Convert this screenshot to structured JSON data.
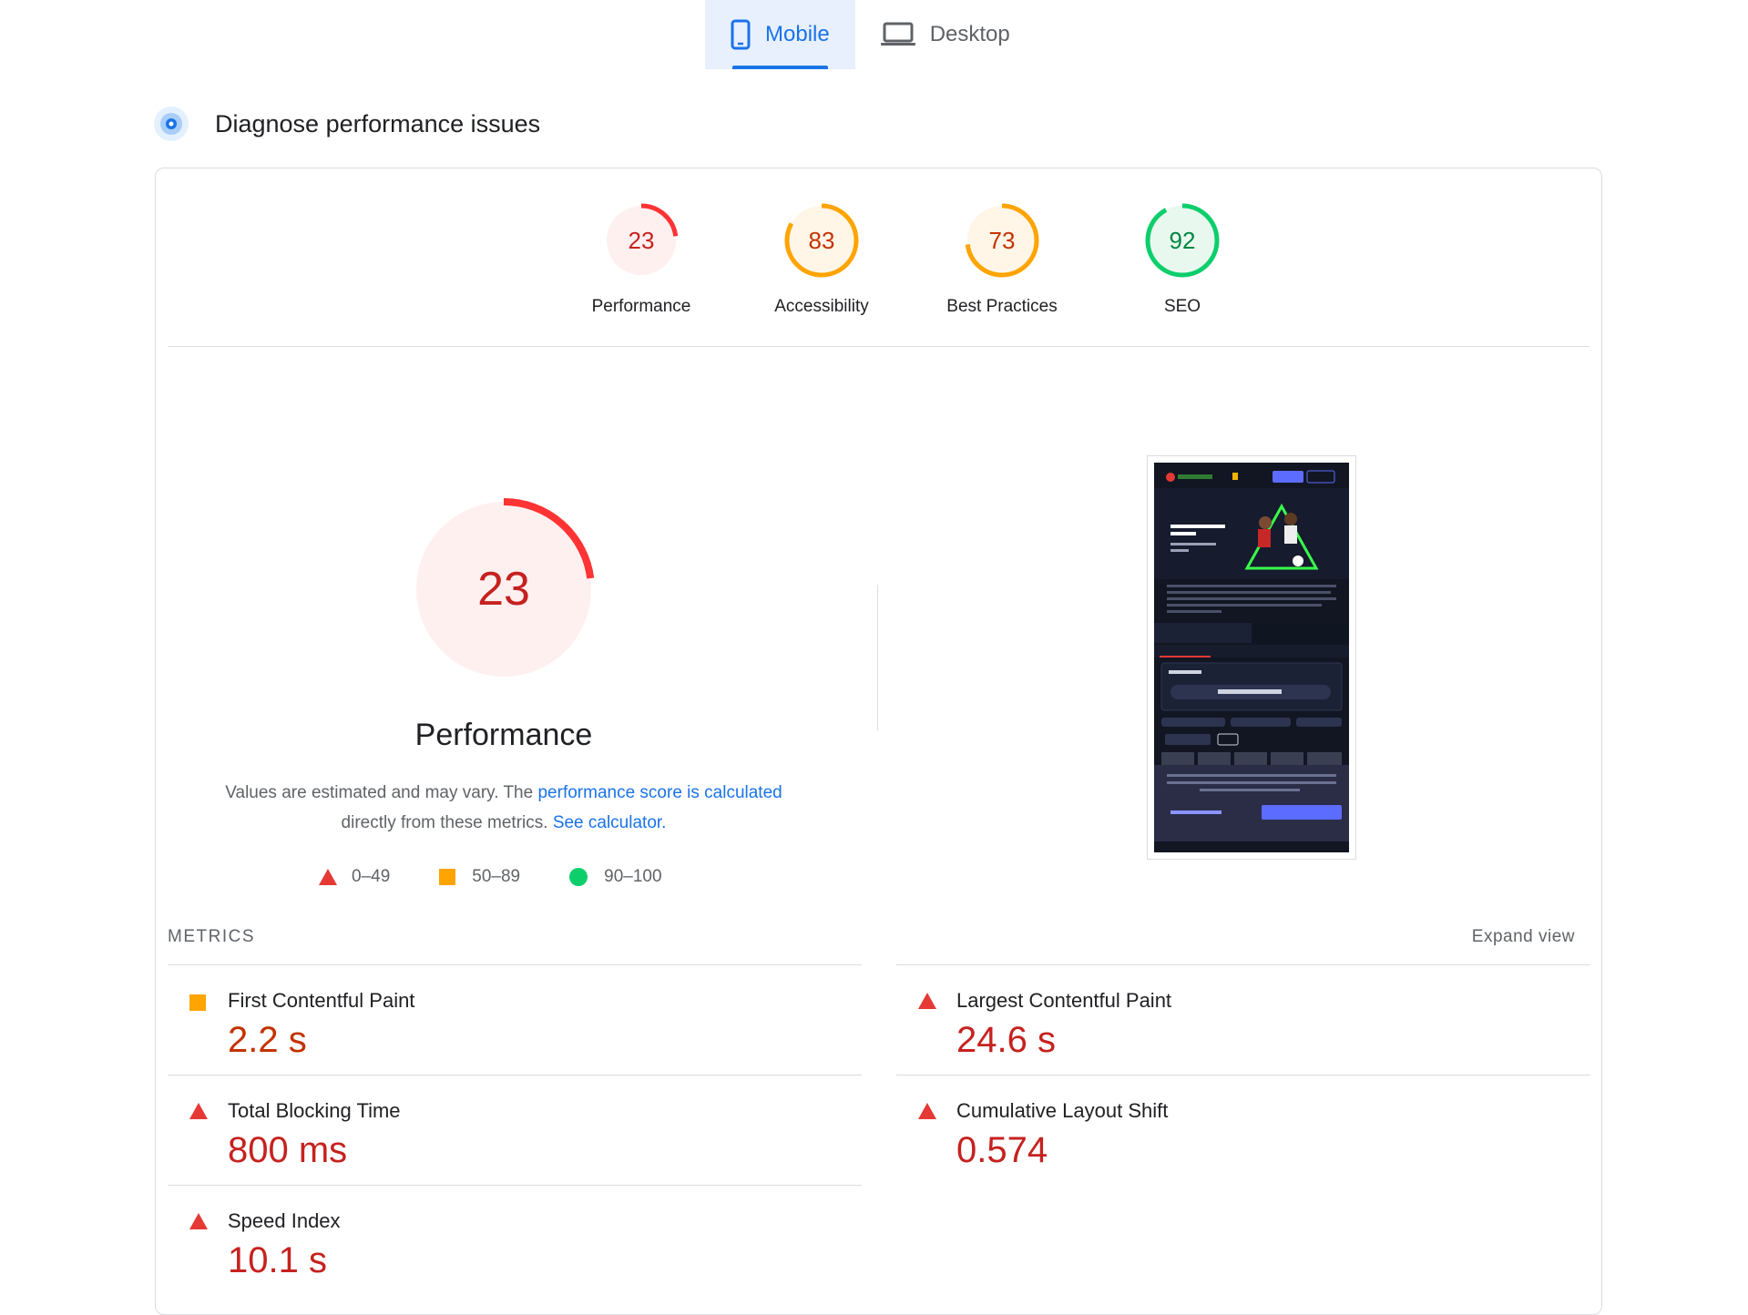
{
  "tabs": [
    {
      "label": "Mobile",
      "active": true,
      "icon": "phone-icon"
    },
    {
      "label": "Desktop",
      "active": false,
      "icon": "laptop-icon"
    }
  ],
  "diagnose": {
    "title": "Diagnose performance issues",
    "icon": "diagnose-icon"
  },
  "categories": [
    {
      "score": "23",
      "label": "Performance",
      "rating": "fail",
      "color": "#ff3333"
    },
    {
      "score": "83",
      "label": "Accessibility",
      "rating": "average",
      "color": "#ffa400"
    },
    {
      "score": "73",
      "label": "Best Practices",
      "rating": "average",
      "color": "#ffa400"
    },
    {
      "score": "92",
      "label": "SEO",
      "rating": "pass",
      "color": "#0cce6b"
    }
  ],
  "performance": {
    "score": "23",
    "title": "Performance",
    "desc_prefix": "Values are estimated and may vary. The ",
    "desc_link1": "performance score is calculated",
    "desc_middle": " directly from these metrics. ",
    "desc_link2": "See calculator."
  },
  "legend": [
    {
      "range": "0–49",
      "shape": "triangle",
      "color": "#ff3333"
    },
    {
      "range": "50–89",
      "shape": "square",
      "color": "#ffa400"
    },
    {
      "range": "90–100",
      "shape": "circle",
      "color": "#0cce6b"
    }
  ],
  "metrics": {
    "title": "METRICS",
    "expand": "Expand view",
    "items": [
      {
        "name": "First Contentful Paint",
        "value": "2.2 s",
        "rating": "average"
      },
      {
        "name": "Largest Contentful Paint",
        "value": "24.6 s",
        "rating": "fail"
      },
      {
        "name": "Total Blocking Time",
        "value": "800 ms",
        "rating": "fail"
      },
      {
        "name": "Cumulative Layout Shift",
        "value": "0.574",
        "rating": "fail"
      },
      {
        "name": "Speed Index",
        "value": "10.1 s",
        "rating": "fail"
      }
    ]
  },
  "colors": {
    "fail": "#ff3333",
    "average": "#ffa400",
    "pass": "#0cce6b",
    "link": "#1a73e8"
  }
}
